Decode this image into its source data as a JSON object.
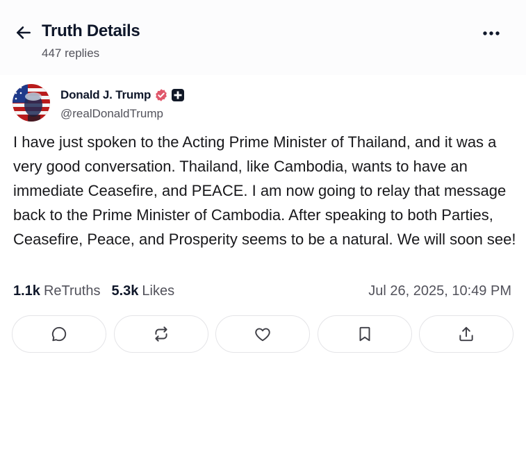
{
  "header": {
    "title": "Truth Details",
    "subtitle": "447 replies"
  },
  "post": {
    "author_name": "Donald J. Trump",
    "handle": "@realDonaldTrump",
    "text": "I have just spoken to the Acting Prime Minister of Thailand, and it was a very good conversation. Thailand, like Cambodia, wants to have an immediate Ceasefire, and PEACE. I am now going to relay that message back to the Prime Minister of Cambodia. After speaking to both Parties, Ceasefire, Peace, and Prosperity seems to be a natural. We will soon see!",
    "retruths_count": "1.1k",
    "retruths_label": "ReTruths",
    "likes_count": "5.3k",
    "likes_label": "Likes",
    "timestamp": "Jul 26, 2025, 10:49 PM"
  },
  "actions": [
    {
      "icon": "reply-icon"
    },
    {
      "icon": "retruth-icon"
    },
    {
      "icon": "heart-icon"
    },
    {
      "icon": "bookmark-icon"
    },
    {
      "icon": "share-icon"
    }
  ],
  "colors": {
    "verified_badge": "#e0576b",
    "text_primary": "#0f172a",
    "text_secondary": "#52525b",
    "border": "#e4e4e7"
  }
}
